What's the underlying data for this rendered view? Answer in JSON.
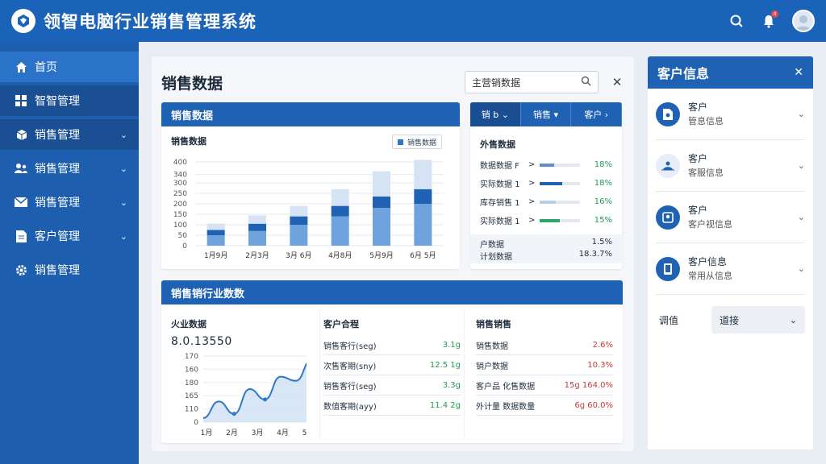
{
  "header": {
    "app_title": "领智电脑行业销售管理系统",
    "notification_count": "4"
  },
  "sidebar": {
    "items": [
      {
        "label": "首页",
        "icon": "home-icon"
      },
      {
        "label": "智智管理",
        "icon": "grid-icon"
      },
      {
        "label": "销售管理",
        "icon": "box-icon"
      },
      {
        "label": "销售管理",
        "icon": "users-icon"
      },
      {
        "label": "销售管理",
        "icon": "mail-icon"
      },
      {
        "label": "客户管理",
        "icon": "document-icon"
      },
      {
        "label": "销售管理",
        "icon": "gear-icon"
      }
    ]
  },
  "main": {
    "title": "销售数据",
    "search_placeholder": "主营销数据",
    "bar_card": {
      "title": "销售数据",
      "subtitle": "销售数据",
      "legend_chip": "销售数据"
    },
    "tabs_card": {
      "tabs": [
        "销  b",
        "销售",
        "客户"
      ],
      "subtitle": "外售数据",
      "rows": [
        {
          "label": "数据数据 F",
          "arrow": ">",
          "fill": 0.35,
          "color": "#5b8fd1",
          "pct": "18%"
        },
        {
          "label": "实际数据 1",
          "arrow": ">",
          "fill": 0.55,
          "color": "#1f62b3",
          "pct": "18%"
        },
        {
          "label": "库存销售 1",
          "arrow": ">",
          "fill": 0.4,
          "color": "#b7cde8",
          "pct": "16%"
        },
        {
          "label": "实际数据 1",
          "arrow": ">",
          "fill": 0.5,
          "color": "#2aa66a",
          "pct": "15%"
        }
      ],
      "footer": [
        {
          "label": "户数据",
          "value": "1.5%"
        },
        {
          "label": "计划数据",
          "value": "18.3.7%"
        }
      ]
    },
    "wide_card": {
      "title": "销售销行业数数",
      "line_pane": {
        "title": "火业数据",
        "big_number": "8.0.13550"
      },
      "mid_pane": {
        "title": "客户合程",
        "rows": [
          {
            "label": "销售客行(seg)",
            "value": "3.1g"
          },
          {
            "label": "次售客期(sny)",
            "value": "12.5 1g"
          },
          {
            "label": "销售客行(seg)",
            "value": "3.3g"
          },
          {
            "label": "数值客期(ayy)",
            "value": "11.4 2g"
          }
        ]
      },
      "right_pane": {
        "title": "销售销售",
        "rows": [
          {
            "label": "销售数据",
            "value": "2.6%"
          },
          {
            "label": "销户数据",
            "value": "10.3%"
          },
          {
            "label": "客户品 化售数据",
            "value": "15g 164.0%"
          },
          {
            "label": "外计量 数据数量",
            "value": "6g 60.0%"
          }
        ]
      }
    }
  },
  "chart_data": [
    {
      "type": "bar",
      "categories": [
        "1月9月",
        "2月3月",
        "3月 6月",
        "4月8月",
        "5月9月",
        "6月 5月"
      ],
      "series": [
        {
          "values": [
            50,
            70,
            100,
            140,
            180,
            200
          ],
          "color": "#6fa3de"
        },
        {
          "values": [
            25,
            35,
            40,
            50,
            55,
            70
          ],
          "color": "#1f62b3"
        },
        {
          "values": [
            30,
            40,
            50,
            80,
            120,
            140
          ],
          "color": "#d5e3f4"
        }
      ],
      "yticks": [
        "0",
        "50",
        "100",
        "150",
        "200",
        "250",
        "300",
        "340",
        "400"
      ],
      "ylim": [
        0,
        400
      ],
      "stacked": true
    },
    {
      "type": "area",
      "x": [
        "1月",
        "2月",
        "3月",
        "4月",
        "5月"
      ],
      "values": [
        110,
        150,
        120,
        180,
        155,
        210,
        200,
        250
      ],
      "yticks": [
        "0",
        "110",
        "165",
        "180",
        "160",
        "170"
      ],
      "ylim": [
        100,
        260
      ]
    }
  ],
  "right_panel": {
    "title": "客户信息",
    "items": [
      {
        "title": "客户",
        "sub": "管息信息",
        "icon": "document-icon",
        "light": false
      },
      {
        "title": "客户",
        "sub": "客服信息",
        "icon": "team-icon",
        "light": true
      },
      {
        "title": "客户",
        "sub": "客户视信息",
        "icon": "id-card-icon",
        "light": false
      },
      {
        "title": "客户信息",
        "sub": "常用从信息",
        "icon": "tablet-icon",
        "light": false
      }
    ],
    "select_label": "调值",
    "select_value": "道接"
  }
}
